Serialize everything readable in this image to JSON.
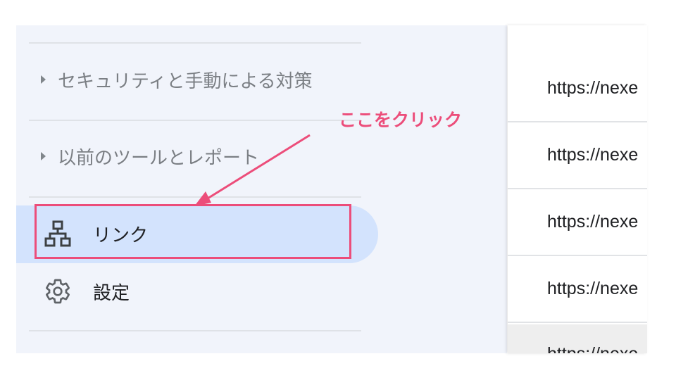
{
  "sidebar": {
    "sections": [
      {
        "label": "セキュリティと手動による対策"
      },
      {
        "label": "以前のツールとレポート"
      }
    ],
    "items": [
      {
        "label": "リンク",
        "icon": "sitemap-icon",
        "active": true
      },
      {
        "label": "設定",
        "icon": "gear-icon",
        "active": false
      }
    ]
  },
  "annotation": {
    "text": "ここをクリック",
    "color": "#ec4d7a"
  },
  "links": {
    "rows": [
      "https://nexe",
      "https://nexe",
      "https://nexe",
      "https://nexe",
      "https://nexe"
    ]
  },
  "colors": {
    "active_bg": "#d3e3fd",
    "sidebar_bg": "#f1f4fb",
    "highlight": "#ec4d7a"
  }
}
